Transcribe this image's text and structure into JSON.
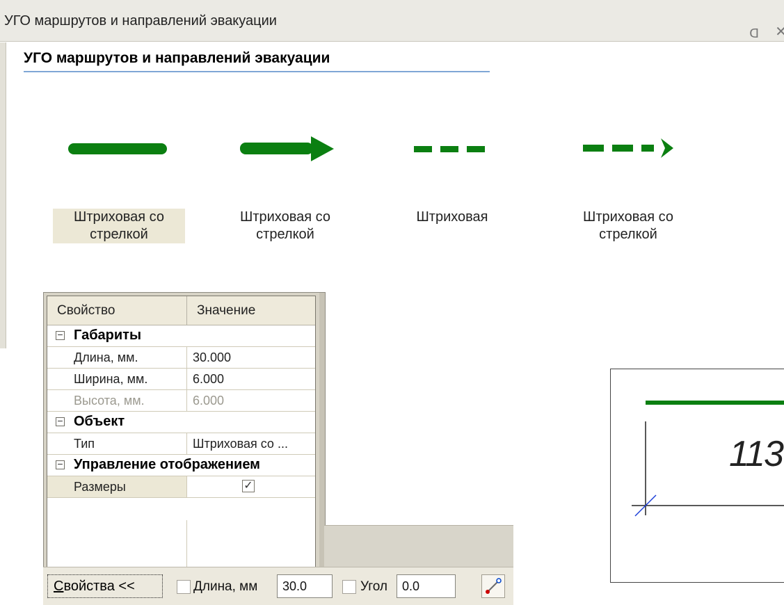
{
  "window": {
    "title": "УГО маршрутов и направлений эвакуации",
    "pin_icon": "pin-icon",
    "close_icon": "close-icon"
  },
  "section_title": "УГО маршрутов и направлений эвакуации",
  "symbols": [
    {
      "label_line1": "Штриховая со",
      "label_line2": "стрелкой",
      "style": "solid-line",
      "selected": true
    },
    {
      "label_line1": "Штриховая со",
      "label_line2": "стрелкой",
      "style": "solid-arrow",
      "selected": false
    },
    {
      "label_line1": "Штриховая",
      "label_line2": "",
      "style": "dashed-line",
      "selected": false
    },
    {
      "label_line1": "Штриховая со",
      "label_line2": "стрелкой",
      "style": "dashed-arrow",
      "selected": false
    }
  ],
  "property_grid": {
    "headers": {
      "property": "Свойство",
      "value": "Значение"
    },
    "groups": {
      "gabarity": {
        "title": "Габариты",
        "rows": [
          {
            "name": "Длина, мм.",
            "value": "30.000",
            "disabled": false
          },
          {
            "name": "Ширина, мм.",
            "value": "6.000",
            "disabled": false
          },
          {
            "name": "Высота, мм.",
            "value": "6.000",
            "disabled": true
          }
        ]
      },
      "object": {
        "title": "Объект",
        "rows": [
          {
            "name": "Тип",
            "value": "Штриховая со ...",
            "disabled": false
          }
        ]
      },
      "display": {
        "title": "Управление отображением",
        "rows": [
          {
            "name": "Размеры",
            "checked": true
          }
        ]
      }
    }
  },
  "statusbar": {
    "props_button_prefix": "С",
    "props_button_rest": "войства  <<",
    "length_label": "Длина, мм",
    "length_value": "30.0",
    "angle_label": "Угол",
    "angle_value": "0.0"
  },
  "preview": {
    "dimension_text": "113"
  },
  "colors": {
    "symbol_green": "#0b7f11",
    "selected_bg": "#ece8d6"
  }
}
